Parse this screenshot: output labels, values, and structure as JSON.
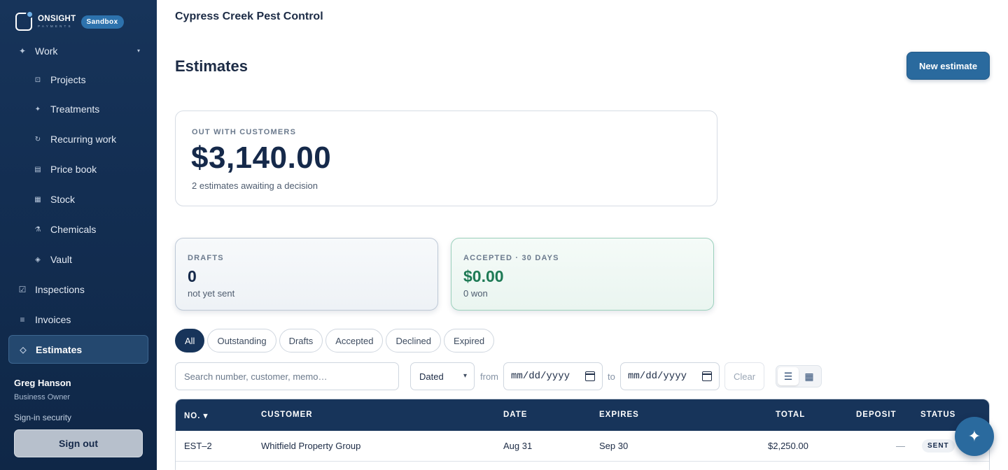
{
  "brand": {
    "name": "ONSIGHT",
    "sub": "PAYMENTS",
    "badge": "Sandbox"
  },
  "sidebar": {
    "items": [
      {
        "label": "Work",
        "icon": "✦"
      },
      {
        "label": "Projects",
        "icon": "⊡"
      },
      {
        "label": "Treatments",
        "icon": "✦"
      },
      {
        "label": "Recurring work",
        "icon": "↻"
      },
      {
        "label": "Price book",
        "icon": "▤"
      },
      {
        "label": "Stock",
        "icon": "▦"
      },
      {
        "label": "Chemicals",
        "icon": "⚗"
      },
      {
        "label": "Vault",
        "icon": "◈"
      },
      {
        "label": "Inspections",
        "icon": "☑"
      },
      {
        "label": "Invoices",
        "icon": "≡"
      },
      {
        "label": "Estimates",
        "icon": "◇"
      }
    ],
    "caret": "▾"
  },
  "user": {
    "name": "Greg Hanson",
    "role": "Business Owner",
    "security_link": "Sign-in security",
    "signout": "Sign out"
  },
  "header": {
    "company": "Cypress Creek Pest Control",
    "title": "Estimates",
    "new_button": "New estimate"
  },
  "summary": {
    "main": {
      "label": "OUT WITH CUSTOMERS",
      "amount": "$3,140.00",
      "sub": "2 estimates awaiting a decision"
    },
    "drafts": {
      "label": "DRAFTS",
      "value": "0",
      "sub": "not yet sent"
    },
    "accepted": {
      "label": "ACCEPTED · 30 DAYS",
      "value": "$0.00",
      "sub": "0 won"
    }
  },
  "tabs": [
    "All",
    "Outstanding",
    "Drafts",
    "Accepted",
    "Declined",
    "Expired"
  ],
  "filters": {
    "search_placeholder": "Search number, customer, memo…",
    "date_type": "Dated",
    "from_label": "from",
    "to_label": "to",
    "date_placeholder": "mm/dd/yyyy",
    "clear": "Clear"
  },
  "table": {
    "headers": {
      "no": "NO. ▾",
      "customer": "CUSTOMER",
      "date": "DATE",
      "expires": "EXPIRES",
      "total": "TOTAL",
      "deposit": "DEPOSIT",
      "status": "STATUS"
    },
    "rows": [
      {
        "no": "EST–2",
        "customer": "Whitfield Property Group",
        "date": "Aug 31",
        "expires": "Sep 30",
        "total": "$2,250.00",
        "deposit": "—",
        "status": "SENT"
      }
    ]
  },
  "colors": {
    "sidebar": "#17345a",
    "accent": "#2a6a9e",
    "success": "#1e7a55"
  }
}
